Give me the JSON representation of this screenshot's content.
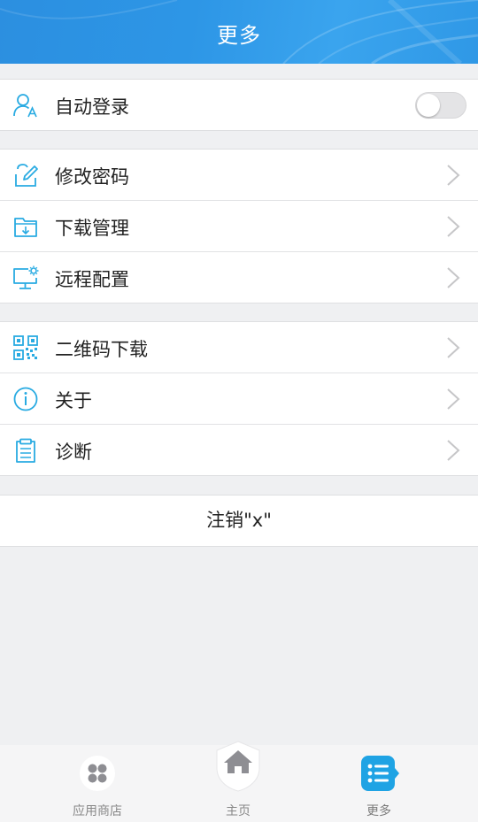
{
  "header": {
    "title": "更多"
  },
  "auto_login": {
    "label": "自动登录",
    "icon": "user-a-icon",
    "enabled": false
  },
  "group2": [
    {
      "label": "修改密码",
      "icon": "edit-icon"
    },
    {
      "label": "下载管理",
      "icon": "folder-download-icon"
    },
    {
      "label": "远程配置",
      "icon": "monitor-gear-icon"
    }
  ],
  "group3": [
    {
      "label": "二维码下载",
      "icon": "qr-code-icon"
    },
    {
      "label": "关于",
      "icon": "info-icon"
    },
    {
      "label": "诊断",
      "icon": "clipboard-icon"
    }
  ],
  "logout": {
    "label": "注销\"x\""
  },
  "tabbar": [
    {
      "label": "应用商店",
      "icon": "apps-icon"
    },
    {
      "label": "主页",
      "icon": "home-icon"
    },
    {
      "label": "更多",
      "icon": "list-icon"
    }
  ],
  "colors": {
    "accent": "#29abe2",
    "header": "#2d95e5"
  }
}
